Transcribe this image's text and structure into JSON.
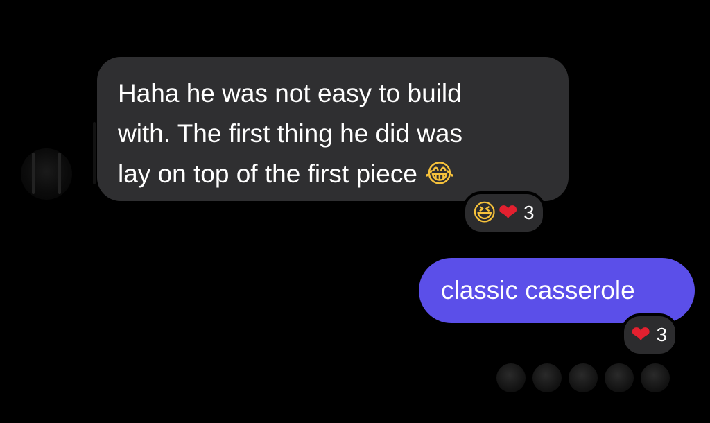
{
  "incoming": {
    "message": "Haha he was not easy to build\nwith. The first thing he did was\nlay on top of the first piece",
    "inline_emoji": "😂",
    "reactions": {
      "emojis": [
        "😆",
        "❤"
      ],
      "count": "3"
    }
  },
  "outgoing": {
    "message": "classic casserole",
    "reactions": {
      "emojis": [
        "❤"
      ],
      "count": "3"
    }
  },
  "colors": {
    "background": "#000000",
    "incoming_bubble": "#2f2f31",
    "outgoing_bubble": "#5b4fe9",
    "reaction_pill": "#2c2c2e"
  }
}
